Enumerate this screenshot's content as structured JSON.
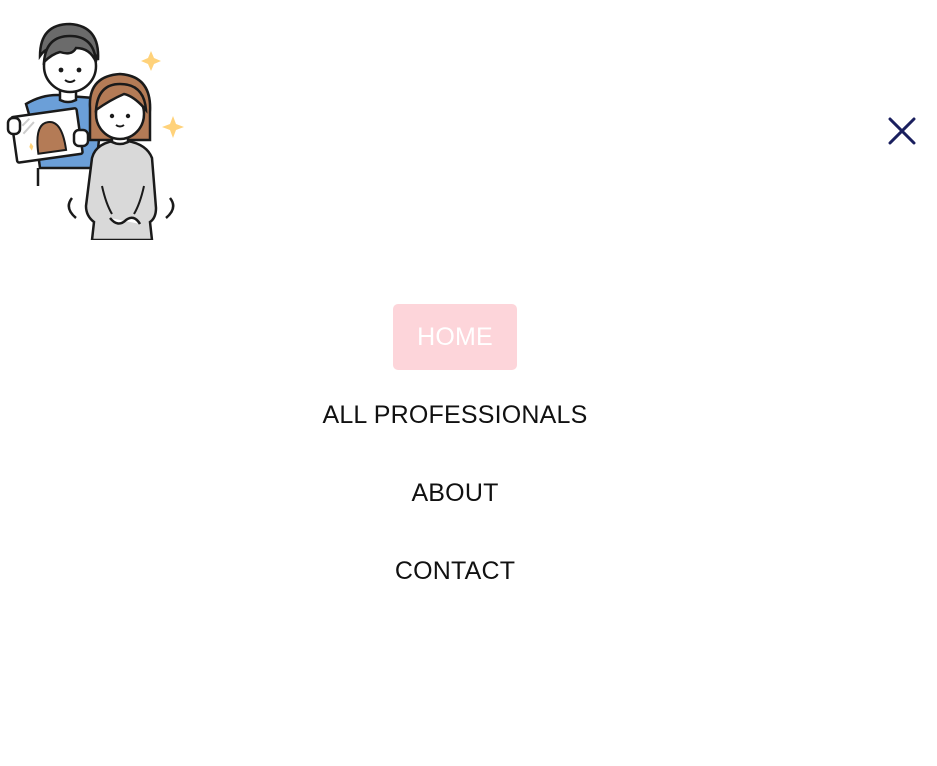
{
  "header": {
    "logo_icon": "couple-illustration-logo",
    "close_icon": "close-icon",
    "close_color": "#1a1f5e"
  },
  "nav": {
    "items": [
      {
        "label": "HOME",
        "active": true
      },
      {
        "label": "ALL PROFESSIONALS",
        "active": false
      },
      {
        "label": "ABOUT",
        "active": false
      },
      {
        "label": "CONTACT",
        "active": false
      }
    ],
    "active_bg": "#fdd5da",
    "active_text_color": "#ffffff",
    "text_color": "#111111"
  }
}
